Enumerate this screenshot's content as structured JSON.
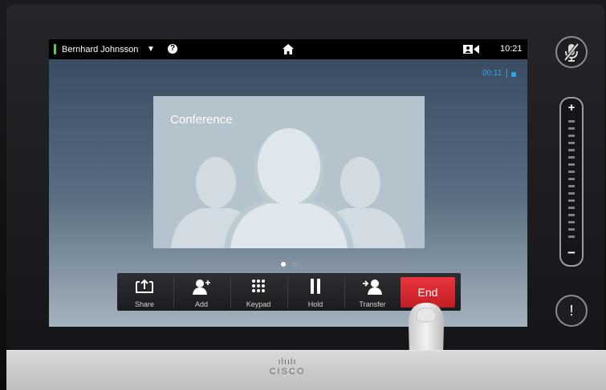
{
  "status_bar": {
    "caller_name": "Bernhard Johnsson",
    "caret": "▼",
    "help": "?",
    "time": "10:21"
  },
  "call": {
    "duration": "00:11"
  },
  "conference": {
    "label": "Conference",
    "page_count": 2,
    "active_page": 1
  },
  "toolbar": {
    "items": [
      {
        "label": "Share",
        "icon": "share-icon"
      },
      {
        "label": "Add",
        "icon": "add-user-icon"
      },
      {
        "label": "Keypad",
        "icon": "keypad-icon"
      },
      {
        "label": "Hold",
        "icon": "pause-icon"
      },
      {
        "label": "Transfer",
        "icon": "transfer-icon"
      }
    ],
    "end_label": "End"
  },
  "side_controls": {
    "volume_plus": "+",
    "volume_minus": "−",
    "alert": "!"
  },
  "brand": {
    "bars": "ılıılı",
    "word": "CISCO"
  },
  "colors": {
    "accent_blue": "#2ea3ea",
    "end_red": "#e0262e",
    "status_green": "#5fcf2a"
  }
}
